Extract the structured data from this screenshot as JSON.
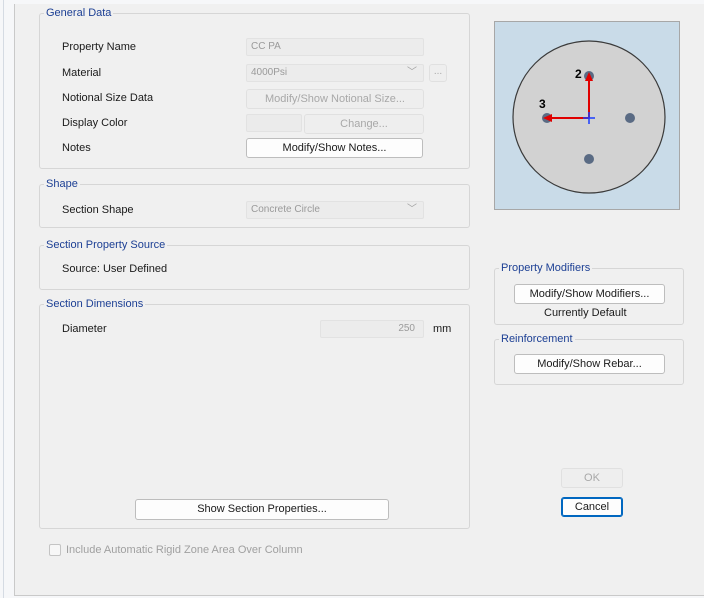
{
  "general": {
    "title": "General Data",
    "property_name_label": "Property Name",
    "property_name_value": "CC PA",
    "material_label": "Material",
    "material_value": "4000Psi",
    "material_more": "...",
    "notional_label": "Notional Size Data",
    "notional_button": "Modify/Show Notional Size...",
    "color_label": "Display Color",
    "color_button": "Change...",
    "notes_label": "Notes",
    "notes_button": "Modify/Show Notes..."
  },
  "shape": {
    "title": "Shape",
    "section_shape_label": "Section Shape",
    "section_shape_value": "Concrete Circle"
  },
  "source": {
    "title": "Section Property Source",
    "text": "Source:  User Defined"
  },
  "dimensions": {
    "title": "Section Dimensions",
    "diameter_label": "Diameter",
    "diameter_value": "250",
    "diameter_unit": "mm",
    "show_props_button": "Show Section Properties..."
  },
  "preview": {
    "axis_2_label": "2",
    "axis_3_label": "3",
    "colors": {
      "background": "#c9dbe8",
      "section_fill": "#d2d2d2",
      "rebar": "#5a6b84",
      "axis_2": "#e00000",
      "axis_3": "#e00000",
      "center_cross": "#1a3cff"
    }
  },
  "modifiers": {
    "title": "Property Modifiers",
    "button": "Modify/Show Modifiers...",
    "status": "Currently Default"
  },
  "reinforcement": {
    "title": "Reinforcement",
    "button": "Modify/Show Rebar..."
  },
  "actions": {
    "ok": "OK",
    "cancel": "Cancel"
  },
  "rigid_zone": {
    "label": "Include Automatic Rigid Zone Area Over Column",
    "checked": false
  }
}
